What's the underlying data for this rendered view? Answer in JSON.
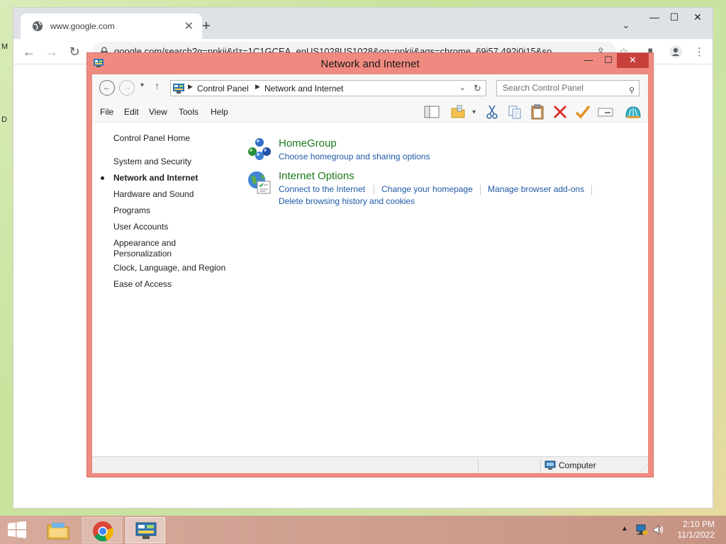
{
  "browser": {
    "tab_title": "www.google.com",
    "tab_close": "✕",
    "new_tab": "+",
    "url": "google.com/search?q=ppkii&rlz=1C1GCEA_enUS1028US1028&oq=ppkii&aqs=chrome..69i57.492j0j15&so",
    "back": "←",
    "forward": "→",
    "reload": "↻",
    "minimize": "—",
    "maximize": "☐",
    "close": "✕"
  },
  "desktop": {
    "peek_top": "M",
    "peek_mid": "D"
  },
  "window": {
    "title": "Network and Internet",
    "minimize": "—",
    "maximize": "☐",
    "close": "✕"
  },
  "address_bar": {
    "back": "←",
    "forward": "→",
    "history": "▾",
    "up": "↑",
    "crumbs": [
      "Control Panel",
      "Network and Internet"
    ],
    "crumb_sep": "▶",
    "dropdown": "⌄",
    "refresh": "↻"
  },
  "search": {
    "placeholder": "Search Control Panel"
  },
  "menu": {
    "items": [
      "File",
      "Edit",
      "View",
      "Tools",
      "Help"
    ]
  },
  "toolbar": {
    "icons": [
      "layout-icon",
      "folder-view-icon",
      "cut-icon",
      "copy-icon",
      "paste-icon",
      "delete-icon",
      "properties-check-icon",
      "rename-icon",
      "shell-icon"
    ],
    "dropdown": "▾"
  },
  "sidebar": {
    "home": "Control Panel Home",
    "items": [
      {
        "label": "System and Security",
        "active": false
      },
      {
        "label": "Network and Internet",
        "active": true
      },
      {
        "label": "Hardware and Sound",
        "active": false
      },
      {
        "label": "Programs",
        "active": false
      },
      {
        "label": "User Accounts",
        "active": false
      },
      {
        "label": "Appearance and\nPersonalization",
        "active": false
      },
      {
        "label": "Clock, Language, and Region",
        "active": false
      },
      {
        "label": "Ease of Access",
        "active": false
      }
    ]
  },
  "categories": [
    {
      "title": "HomeGroup",
      "icon": "homegroup-icon",
      "links": [
        "Choose homegroup and sharing options"
      ]
    },
    {
      "title": "Internet Options",
      "icon": "internet-options-icon",
      "links": [
        "Connect to the Internet",
        "Change your homepage",
        "Manage browser add-ons",
        "Delete browsing history and cookies"
      ]
    }
  ],
  "statusbar": {
    "location": "Computer"
  },
  "taskbar": {
    "clock_time": "2:10 PM",
    "clock_date": "11/1/2022",
    "tray_arrow": "▲",
    "apps": [
      "file-explorer-icon",
      "chrome-icon",
      "control-panel-icon"
    ]
  },
  "colors": {
    "window_frame": "#f08a80",
    "window_close": "#c7403b",
    "category_title": "#1c7a1c",
    "link": "#1f5aa6",
    "taskbar": "#d7aa9b"
  }
}
